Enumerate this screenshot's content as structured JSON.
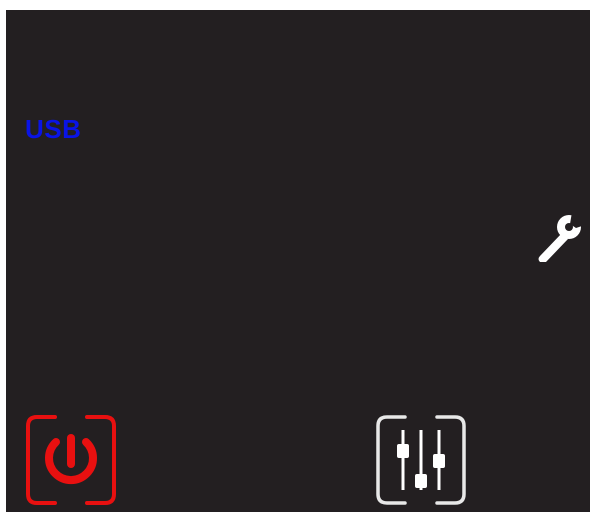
{
  "source": {
    "label": "USB",
    "color": "#0a14e6"
  },
  "icons": {
    "settings": "wrench-icon",
    "power": "power-icon",
    "equalizer": "sliders-icon"
  },
  "colors": {
    "background": "#231f21",
    "power_accent": "#e81010",
    "icon_white": "#e8e8e8"
  }
}
